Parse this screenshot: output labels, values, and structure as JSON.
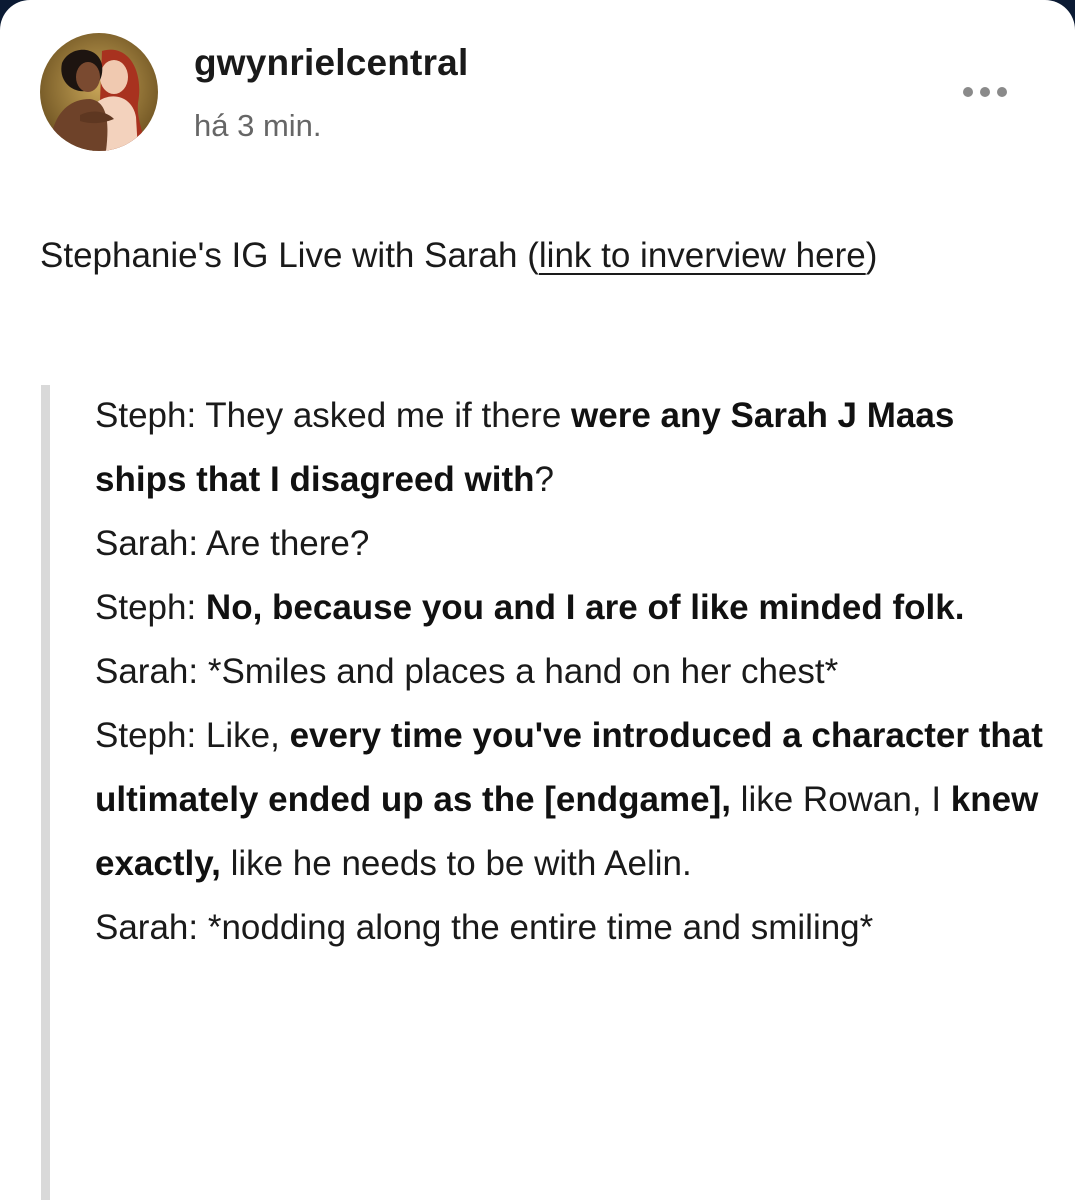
{
  "post": {
    "username": "gwynrielcentral",
    "timestamp": "há 3 min.",
    "avatar_icon": "couple-portrait-avatar",
    "more_icon": "more-options-icon",
    "intro": {
      "text_before": "Stephanie's IG Live with Sarah (",
      "link_text": "link to inverview here",
      "text_after": ")"
    },
    "quote": {
      "lines": [
        {
          "segments": [
            {
              "text": "Steph: They asked me if there ",
              "bold": false
            },
            {
              "text": "were any Sarah J Maas ships that I disagreed with",
              "bold": true
            },
            {
              "text": "?",
              "bold": false
            }
          ]
        },
        {
          "segments": [
            {
              "text": "Sarah: Are there?",
              "bold": false
            }
          ]
        },
        {
          "segments": [
            {
              "text": "Steph: ",
              "bold": false
            },
            {
              "text": "No, because you and I are of like minded folk.",
              "bold": true
            }
          ]
        },
        {
          "segments": [
            {
              "text": "Sarah: *Smiles and places a hand on her chest*",
              "bold": false
            }
          ]
        },
        {
          "segments": [
            {
              "text": "Steph: Like, ",
              "bold": false
            },
            {
              "text": "every time you've introduced a character that ultimately ended up as the [endgame],",
              "bold": true
            },
            {
              "text": " like Rowan, I ",
              "bold": false
            },
            {
              "text": "knew exactly,",
              "bold": true
            },
            {
              "text": " like he needs to be with Aelin.",
              "bold": false
            }
          ]
        },
        {
          "segments": [
            {
              "text": "Sarah: *nodding along the entire time and smiling*",
              "bold": false
            }
          ]
        }
      ]
    }
  },
  "colors": {
    "background_outer": "#0b1a33",
    "card": "#ffffff",
    "text": "#1a1a1a",
    "muted": "#666666",
    "quote_bar": "#d9d9d9"
  }
}
